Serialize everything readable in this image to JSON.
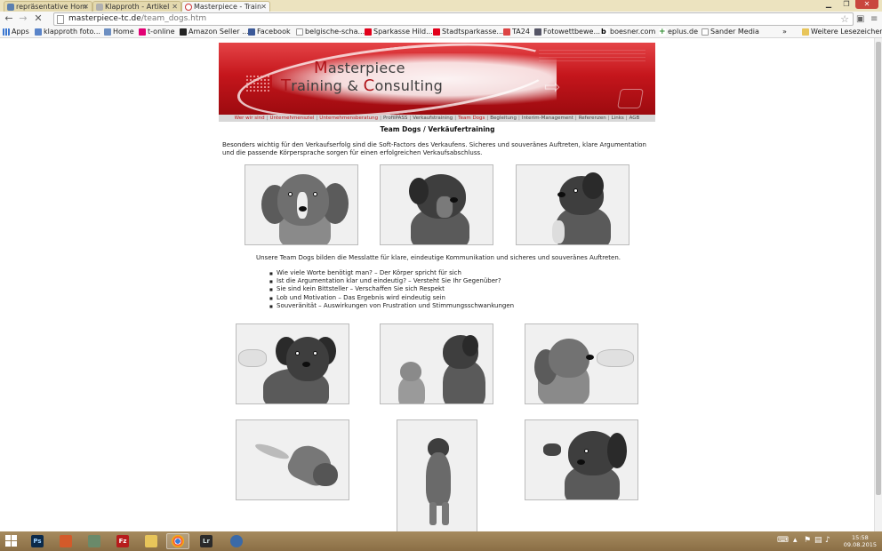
{
  "browser": {
    "tabs": [
      {
        "title": "repräsentative Hom",
        "favicon": "KK"
      },
      {
        "title": "Klapproth - Artikel",
        "favicon": ""
      },
      {
        "title": "Masterpiece - Train",
        "favicon": ""
      }
    ],
    "url_host": "masterpiece-tc.de",
    "url_path": "/team_dogs.htm"
  },
  "bookmarks": [
    "Apps",
    "klapproth foto...",
    "Home",
    "t-online",
    "Amazon Seller ...",
    "Facebook",
    "belgische-scha...",
    "Sparkasse Hild...",
    "Stadtsparkasse...",
    "TA24",
    "Fotowettbewe...",
    "boesner.com",
    "eplus.de",
    "Sander Media",
    "»",
    "Weitere Lesezeichen"
  ],
  "page": {
    "banner": {
      "line1_cap": "M",
      "line1_rest": "asterpiece",
      "line2_cap1": "T",
      "line2_mid": "raining & ",
      "line2_cap2": "C",
      "line2_rest": "onsulting"
    },
    "nav": [
      {
        "label": "Wer wir sind",
        "highlight": true
      },
      {
        "label": "Unternehmensziel",
        "highlight": true
      },
      {
        "label": "Unternehmensberatung",
        "highlight": true
      },
      {
        "label": "ProfilPASS",
        "highlight": false
      },
      {
        "label": "Verkaufstraining",
        "highlight": false
      },
      {
        "label": "Team Dogs",
        "highlight": true
      },
      {
        "label": "Begleitung",
        "highlight": false
      },
      {
        "label": "Interim-Management",
        "highlight": false
      },
      {
        "label": "Referenzen",
        "highlight": false
      },
      {
        "label": "Links",
        "highlight": false
      },
      {
        "label": "AGB",
        "highlight": false
      }
    ],
    "title": "Team Dogs / Verkäufertraining",
    "intro": "Besonders wichtig für den Verkaufserfolg sind die Soft-Factors des Verkaufens. Sicheres und souveränes Auftreten, klare Argumentation und die passende Körpersprache sorgen für einen erfolgreichen Verkaufsabschluss.",
    "team_text": "Unsere Team Dogs bilden die Messlatte für klare, eindeutige Kommunikation und sicheres und souveränes Auftreten.",
    "bullets": [
      "Wie viele Worte benötigt man? – Der Körper spricht für sich",
      "Ist die Argumentation klar und eindeutig? – Versteht Sie Ihr Gegenüber?",
      "Sie sind kein Bittsteller – Verschaffen Sie sich Respekt",
      "Lob und Motivation – Das Ergebnis wird eindeutig sein",
      "Souveränität – Auswirkungen von Frustration und Stimmungsschwankungen"
    ]
  },
  "taskbar": {
    "time": "15:58",
    "date": "09.08.2015"
  },
  "colors": {
    "brand_red": "#c0141a",
    "taskbar": "#9a7d52"
  }
}
